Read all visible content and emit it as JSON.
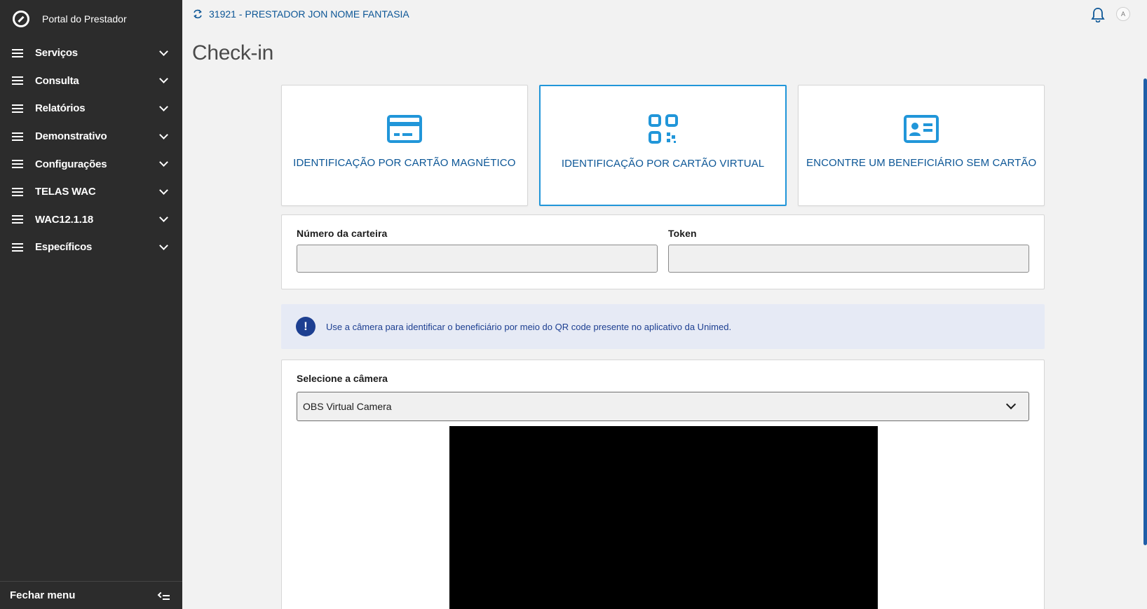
{
  "app": {
    "title": "Portal do Prestador"
  },
  "sidebar": {
    "items": [
      {
        "label": "Serviços"
      },
      {
        "label": "Consulta"
      },
      {
        "label": "Relatórios"
      },
      {
        "label": "Demonstrativo"
      },
      {
        "label": "Configurações"
      },
      {
        "label": "TELAS WAC"
      },
      {
        "label": "WAC12.1.18"
      },
      {
        "label": "Específicos"
      }
    ],
    "footer_label": "Fechar menu"
  },
  "topbar": {
    "provider": "31921 - PRESTADOR JON NOME FANTASIA",
    "avatar_initial": "A"
  },
  "page": {
    "title": "Check-in"
  },
  "cards": [
    {
      "label": "IDENTIFICAÇÃO POR CARTÃO MAGNÉTICO",
      "icon": "credit-card-icon",
      "active": false
    },
    {
      "label": "IDENTIFICAÇÃO POR CARTÃO VIRTUAL",
      "icon": "qr-code-icon",
      "active": true
    },
    {
      "label": "ENCONTRE UM BENEFICIÁRIO SEM CARTÃO",
      "icon": "id-card-icon",
      "active": false
    }
  ],
  "form": {
    "wallet_label": "Número da carteira",
    "wallet_value": "",
    "token_label": "Token",
    "token_value": ""
  },
  "alert": {
    "icon": "!",
    "text": "Use a câmera para identificar o beneficiário por meio do QR code presente no aplicativo da Unimed."
  },
  "camera": {
    "label": "Selecione a câmera",
    "selected": "OBS Virtual Camera"
  },
  "colors": {
    "sidebar_bg": "#2c2c2c",
    "primary": "#0c5696",
    "accent": "#2196d9",
    "alert_bg": "#e6eaf5",
    "alert_fg": "#1d3f91"
  }
}
